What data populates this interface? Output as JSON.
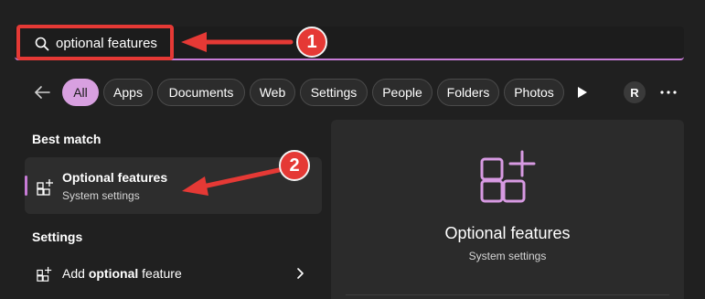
{
  "search": {
    "query": "optional features"
  },
  "filters": {
    "items": [
      "All",
      "Apps",
      "Documents",
      "Web",
      "Settings",
      "People",
      "Folders",
      "Photos"
    ],
    "active": "All",
    "avatar_letter": "R"
  },
  "results": {
    "best_match_heading": "Best match",
    "best_match": {
      "title": "Optional features",
      "subtitle": "System settings"
    },
    "settings_heading": "Settings",
    "settings_item": {
      "prefix": "Add ",
      "highlight": "optional",
      "suffix": " feature"
    }
  },
  "preview": {
    "title": "Optional features",
    "subtitle": "System settings"
  },
  "annotations": {
    "badge_1": "1",
    "badge_2": "2",
    "color": "#e53935"
  },
  "colors": {
    "accent": "#c77bd6",
    "chip_active": "#d8a0e0",
    "background": "#202020"
  },
  "icons": {
    "search": "search-icon",
    "back": "back-arrow-icon",
    "play": "play-icon",
    "more": "more-icon",
    "optional_features": "optional-features-icon",
    "chevron": "chevron-right-icon"
  }
}
